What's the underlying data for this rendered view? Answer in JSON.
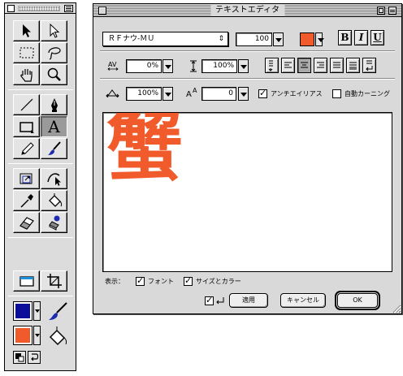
{
  "toolbox": {
    "fill_color": "#0b0e9a",
    "stroke_color": "#f15a2a",
    "tools": [
      {
        "name": "selection-arrow-icon"
      },
      {
        "name": "direct-select-arrow-icon"
      },
      {
        "name": "rect-marquee-icon"
      },
      {
        "name": "lasso-icon"
      },
      {
        "name": "hand-icon"
      },
      {
        "name": "zoom-icon"
      },
      {
        "name": "line-icon"
      },
      {
        "name": "pen-icon"
      },
      {
        "name": "rectangle-icon"
      },
      {
        "name": "text-tool-icon",
        "glyph": "A"
      },
      {
        "name": "pencil-icon"
      },
      {
        "name": "brush-icon"
      },
      {
        "name": "transform-icon"
      },
      {
        "name": "reshape-icon"
      },
      {
        "name": "eyedropper-icon"
      },
      {
        "name": "paint-bucket-icon"
      },
      {
        "name": "eraser-icon"
      },
      {
        "name": "stamp-icon"
      },
      {
        "name": "canvas-icon"
      },
      {
        "name": "crop-icon"
      }
    ]
  },
  "editor": {
    "title": "テキストエディタ",
    "font_name": "ＲＦナウ-ＭＵ",
    "font_size": "100",
    "text_color": "#f15a2a",
    "style_buttons": [
      "B",
      "I",
      "U"
    ],
    "tracking": "0%",
    "leading": "100%",
    "scale": "100%",
    "baseline": "0",
    "antialias_label": "アンチエイリアス",
    "antialias_checked": true,
    "autokern_label": "自動カーニング",
    "autokern_checked": false,
    "content_text": "蟹",
    "display_label": "表示：",
    "font_preview_label": "フォント",
    "font_preview_checked": true,
    "size_color_label": "サイズとカラー",
    "size_color_checked": true,
    "return_checked": true,
    "apply_label": "適用",
    "cancel_label": "キャンセル",
    "ok_label": "OK"
  }
}
